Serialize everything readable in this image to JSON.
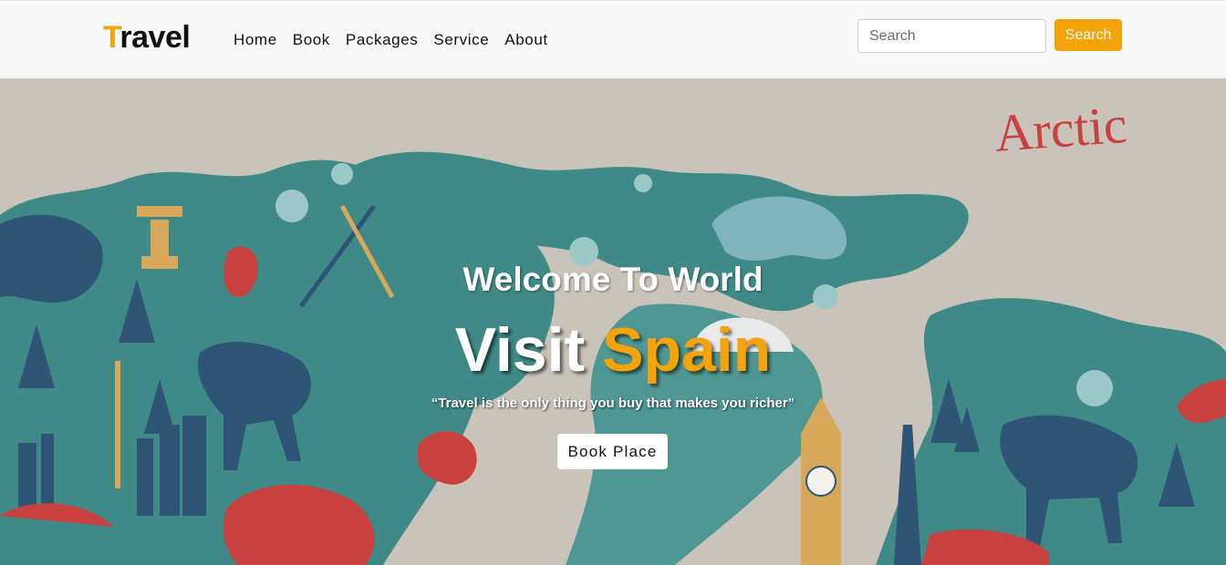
{
  "brand": {
    "first_letter": "T",
    "rest": "ravel"
  },
  "nav": {
    "items": [
      {
        "label": "Home"
      },
      {
        "label": "Book"
      },
      {
        "label": "Packages"
      },
      {
        "label": "Service"
      },
      {
        "label": "About"
      }
    ]
  },
  "search": {
    "placeholder": "Search",
    "value": "",
    "button_label": "Search"
  },
  "hero": {
    "welcome": "Welcome To World",
    "headline_part1": "Visit",
    "headline_part2": "Spain",
    "quote": "“Travel is the only thing you buy that makes you richer”",
    "cta_label": "Book Place",
    "map_label": "Arctic"
  },
  "colors": {
    "accent": "#f5a30a",
    "navbar_bg": "#f8f8f8",
    "map_land": "#3f8a86",
    "map_bg": "#c9c3b9",
    "map_dark": "#2f5576",
    "map_red": "#c8413f"
  }
}
